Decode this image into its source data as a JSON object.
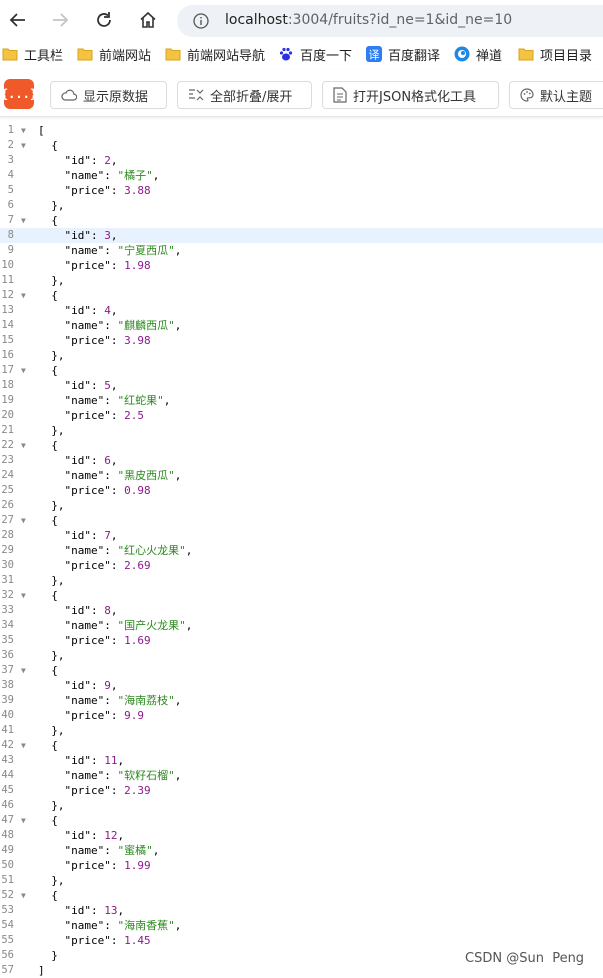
{
  "browser": {
    "url_host": "localhost",
    "url_rest": ":3004/fruits?id_ne=1&id_ne=10"
  },
  "bookmarks": [
    {
      "label": "工具栏",
      "icon": "folder-icon"
    },
    {
      "label": "前端网站",
      "icon": "folder-icon"
    },
    {
      "label": "前端网站导航",
      "icon": "folder-icon"
    },
    {
      "label": "百度一下",
      "icon": "baidu-paw-icon"
    },
    {
      "label": "百度翻译",
      "icon": "translate-icon"
    },
    {
      "label": "禅道",
      "icon": "zentao-icon"
    },
    {
      "label": "项目目录",
      "icon": "folder-icon"
    }
  ],
  "toolbar": {
    "logo_text": "{...}",
    "raw_label": "显示原数据",
    "fold_label": "全部折叠/展开",
    "format_label": "打开JSON格式化工具",
    "theme_label": "默认主题"
  },
  "fruits": [
    {
      "id": 2,
      "name": "橘子",
      "price": 3.88
    },
    {
      "id": 3,
      "name": "宁夏西瓜",
      "price": 1.98
    },
    {
      "id": 4,
      "name": "麒麟西瓜",
      "price": 3.98
    },
    {
      "id": 5,
      "name": "红蛇果",
      "price": 2.5
    },
    {
      "id": 6,
      "name": "黑皮西瓜",
      "price": 0.98
    },
    {
      "id": 7,
      "name": "红心火龙果",
      "price": 2.69
    },
    {
      "id": 8,
      "name": "国产火龙果",
      "price": 1.69
    },
    {
      "id": 9,
      "name": "海南荔枝",
      "price": 9.9
    },
    {
      "id": 11,
      "name": "软籽石榴",
      "price": 2.39
    },
    {
      "id": 12,
      "name": "蜜橘",
      "price": 1.99
    },
    {
      "id": 13,
      "name": "海南香蕉",
      "price": 1.45
    }
  ],
  "active_line": 8,
  "watermark": "CSDN @Sun  Peng"
}
